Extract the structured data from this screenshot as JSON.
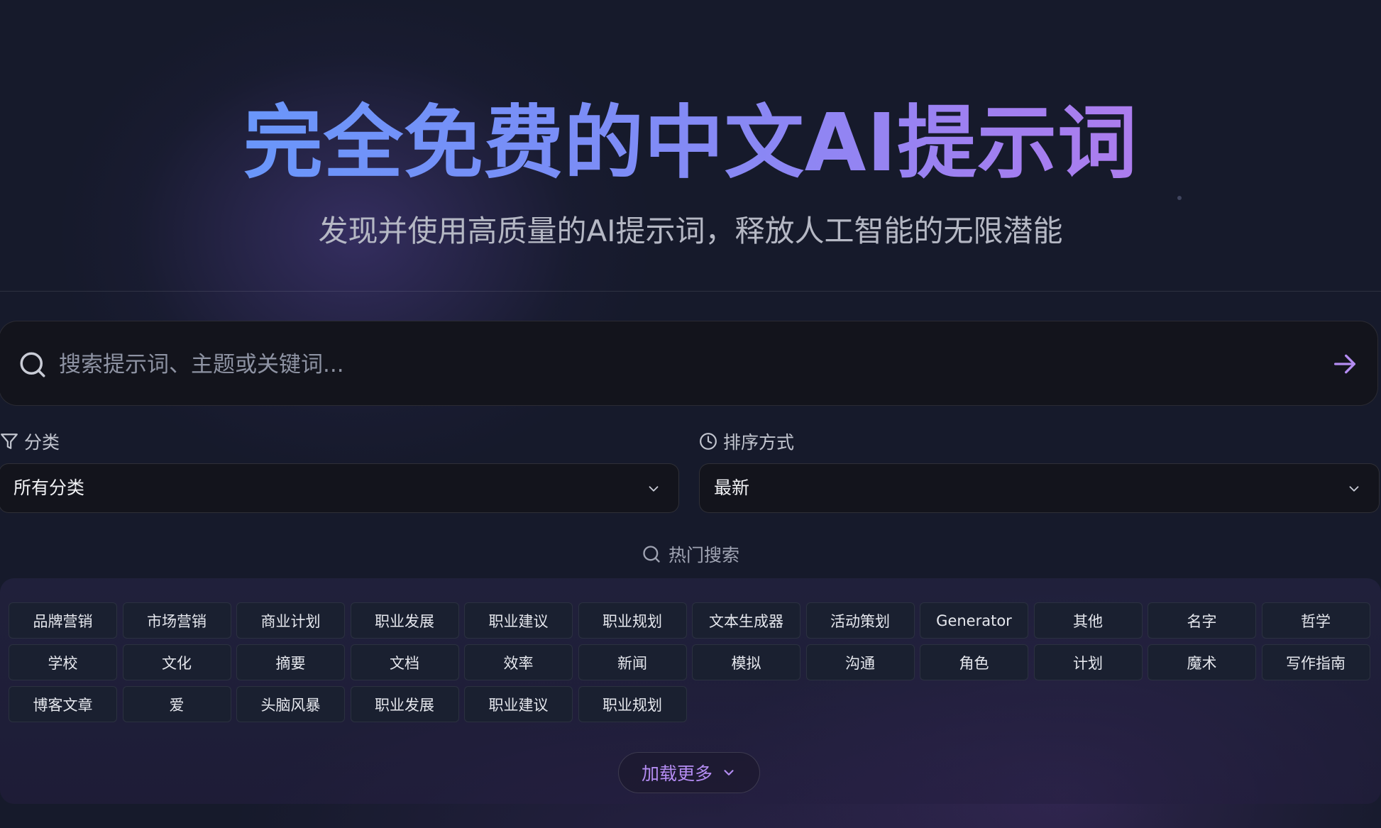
{
  "hero": {
    "title": "完全免费的中文AI提示词",
    "subtitle": "发现并使用高质量的AI提示词，释放人工智能的无限潜能"
  },
  "search": {
    "placeholder": "搜索提示词、主题或关键词..."
  },
  "filters": {
    "category_label": "分类",
    "category_value": "所有分类",
    "sort_label": "排序方式",
    "sort_value": "最新"
  },
  "hot": {
    "label": "热门搜索",
    "tags": [
      "品牌营销",
      "市场营销",
      "商业计划",
      "职业发展",
      "职业建议",
      "职业规划",
      "文本生成器",
      "活动策划",
      "Generator",
      "其他",
      "名字",
      "哲学",
      "学校",
      "文化",
      "摘要",
      "文档",
      "效率",
      "新闻",
      "模拟",
      "沟通",
      "角色",
      "计划",
      "魔术",
      "写作指南",
      "博客文章",
      "爱",
      "头脑风暴",
      "职业发展",
      "职业建议",
      "职业规划"
    ],
    "load_more_label": "加载更多"
  },
  "colors": {
    "background": "#161a2b",
    "accent": "#b48cf2",
    "title_gradient": [
      "#5d9dfd",
      "#c07ae8"
    ]
  },
  "icons": {
    "search": "search-icon",
    "submit": "arrow-right-icon",
    "filter": "funnel-icon",
    "sort": "clock-icon",
    "dropdown": "chevron-down-icon"
  }
}
